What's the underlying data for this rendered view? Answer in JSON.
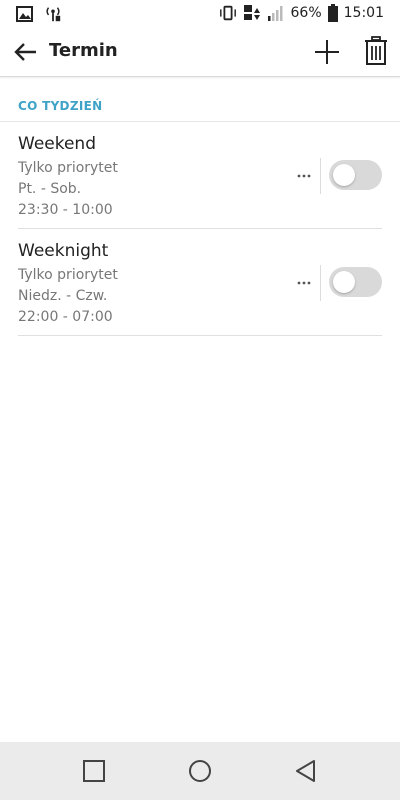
{
  "status_bar": {
    "battery_percent": "66%",
    "time": "15:01",
    "icons": [
      "image-icon",
      "hotspot-icon",
      "vibrate-icon",
      "lte-data-icon",
      "signal-icon",
      "battery-icon"
    ]
  },
  "app_bar": {
    "title": "Termin",
    "icons": [
      "back-arrow-icon",
      "plus-icon",
      "trash-icon"
    ]
  },
  "section": {
    "title": "CO TYDZIEŃ"
  },
  "schedules": [
    {
      "title": "Weekend",
      "mode": "Tylko priorytet",
      "days": "Pt. - Sob.",
      "time": "23:30 - 10:00",
      "enabled": false
    },
    {
      "title": "Weeknight",
      "mode": "Tylko priorytet",
      "days": "Niedz. - Czw.",
      "time": "22:00 - 07:00",
      "enabled": false
    }
  ],
  "nav_bar": {
    "icons": [
      "recents-square-icon",
      "home-circle-icon",
      "back-triangle-icon"
    ]
  },
  "colors": {
    "accent": "#3fa3c7",
    "toggle_off": "#d9d9d9",
    "nav_background": "#ebebeb"
  }
}
